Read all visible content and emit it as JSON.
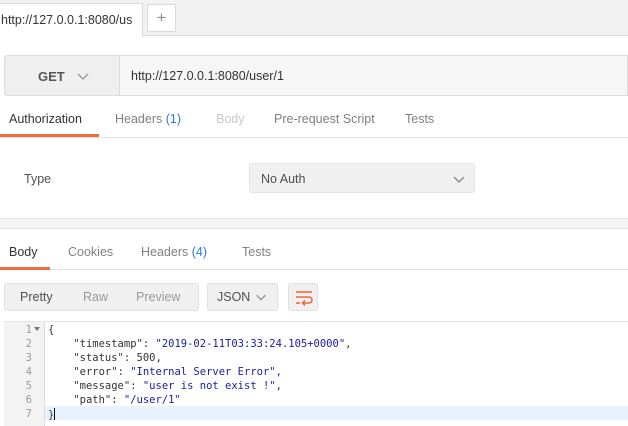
{
  "tab_strip": {
    "tab_title": "http://127.0.0.1:8080/us",
    "add_tab_label": "+"
  },
  "request": {
    "method": "GET",
    "url": "http://127.0.0.1:8080/user/1"
  },
  "request_tabs": {
    "authorization": "Authorization",
    "headers": "Headers",
    "headers_count": "(1)",
    "body": "Body",
    "prerequest": "Pre-request Script",
    "tests": "Tests",
    "active": "Authorization"
  },
  "auth": {
    "type_label": "Type",
    "type_value": "No Auth"
  },
  "response_tabs": {
    "body": "Body",
    "cookies": "Cookies",
    "headers": "Headers",
    "headers_count": "(4)",
    "tests": "Tests",
    "active": "Body"
  },
  "response_toolbar": {
    "pretty": "Pretty",
    "raw": "Raw",
    "preview": "Preview",
    "format": "JSON"
  },
  "response_body": {
    "line_numbers": [
      "1",
      "2",
      "3",
      "4",
      "5",
      "6",
      "7"
    ],
    "open_brace": "{",
    "close_brace": "}",
    "fields": [
      {
        "key": "\"timestamp\"",
        "value": "\"2019-02-11T03:33:24.105+0000\"",
        "kind": "string"
      },
      {
        "key": "\"status\"",
        "value": "500",
        "kind": "number"
      },
      {
        "key": "\"error\"",
        "value": "\"Internal Server Error\"",
        "kind": "string"
      },
      {
        "key": "\"message\"",
        "value": "\"user is not exist !\"",
        "kind": "string"
      },
      {
        "key": "\"path\"",
        "value": "\"/user/1\"",
        "kind": "string"
      }
    ]
  },
  "colors": {
    "accent": "#f26b3a",
    "count_blue": "#2a7bd1",
    "string_blue": "#1a1aa6"
  }
}
